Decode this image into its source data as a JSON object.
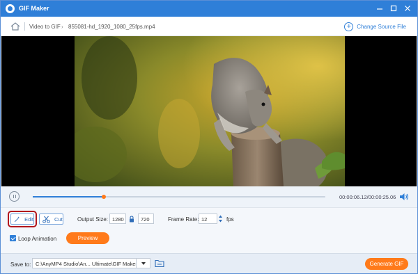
{
  "titlebar": {
    "title": "GIF Maker",
    "icon": "gif-maker-logo-icon",
    "buttons": [
      "minimize-icon",
      "maximize-icon",
      "close-icon"
    ]
  },
  "breadcrumb": {
    "home_icon": "home-icon",
    "section": "Video to GIF",
    "file": "855081-hd_1920_1080_25fps.mp4",
    "change_source_label": "Change Source File"
  },
  "player": {
    "current_time": "00:00:06.12",
    "separator": "/",
    "total_time": "00:00:25.06",
    "progress_fraction": 0.244,
    "pause_icon": "pause-icon",
    "volume_icon": "volume-icon"
  },
  "controls": {
    "edit_label": "Edit",
    "cut_label": "Cut",
    "output_size_label": "Output Size:",
    "width": "1280",
    "height": "720",
    "frame_rate_label": "Frame Rate:",
    "frame_rate": "12",
    "fps_unit": "fps",
    "loop_label": "Loop Animation",
    "loop_checked": true,
    "preview_label": "Preview"
  },
  "footer": {
    "save_to_label": "Save to:",
    "path": "C:\\AnyMP4 Studio\\An... Ultimate\\GIF Maker",
    "generate_label": "Generate GIF"
  },
  "colors": {
    "accent": "#2f7fd8",
    "action": "#ff7a1a",
    "highlight": "#b3161c"
  }
}
